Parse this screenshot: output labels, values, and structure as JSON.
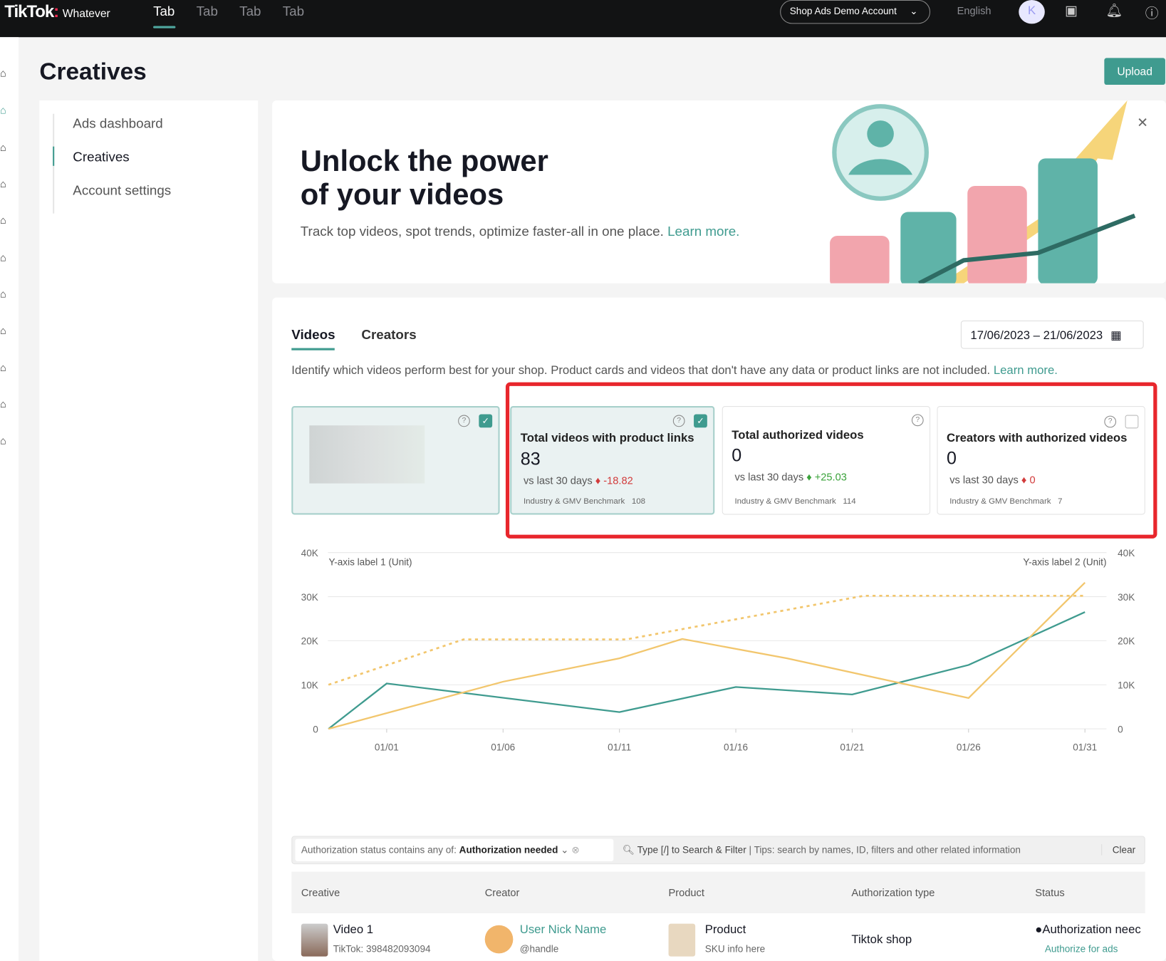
{
  "topbar": {
    "logo": "TikTok",
    "logo_sub": "Whatever",
    "tabs": [
      "Tab",
      "Tab",
      "Tab",
      "Tab"
    ],
    "account": "Shop Ads Demo Account",
    "language": "English",
    "avatar_initial": "K"
  },
  "page": {
    "title": "Creatives",
    "upload": "Upload"
  },
  "nav": {
    "items": [
      "Ads dashboard",
      "Creatives",
      "Account settings"
    ]
  },
  "banner": {
    "title_line1": "Unlock the power",
    "title_line2": "of your videos",
    "text": "Track top videos, spot trends, optimize faster-all in one place.",
    "link": "Learn more."
  },
  "panel": {
    "tabs": [
      "Videos",
      "Creators"
    ],
    "date_start": "17/06/2023",
    "date_sep": "–",
    "date_end": "21/06/2023",
    "description": "Identify which videos perform best for your shop. Product cards and videos that don't have any data or product links are not included.",
    "learn_more": "Learn more."
  },
  "cards": [
    {
      "title": "Total videos with product links",
      "value": "83",
      "vs": "vs last 30 days",
      "arrow": "♦",
      "change": "-18.82",
      "benchmark_label": "Industry & GMV Benchmark",
      "benchmark": "108"
    },
    {
      "title": "Total authorized videos",
      "value": "0",
      "vs": "vs last 30 days",
      "arrow": "♦",
      "change": "+25.03",
      "benchmark_label": "Industry & GMV Benchmark",
      "benchmark": "114"
    },
    {
      "title": "Creators with authorized videos",
      "value": "0",
      "vs": "vs last 30 days",
      "arrow": "♦",
      "change": "0",
      "benchmark_label": "Industry & GMV Benchmark",
      "benchmark": "7"
    }
  ],
  "chart_data": {
    "type": "line",
    "ylabel": "Y-axis label 1 (Unit)",
    "ylabel2": "Y-axis label 2 (Unit)",
    "ylim": [
      0,
      40000
    ],
    "yticks": [
      "0",
      "10K",
      "20K",
      "30K",
      "40K"
    ],
    "xticks": [
      "01/01",
      "01/06",
      "01/11",
      "01/16",
      "01/21",
      "01/26",
      "01/31"
    ],
    "series": [
      {
        "name": "teal",
        "color": "#3f9b8f",
        "dash": false,
        "points": [
          [
            -2.5,
            0
          ],
          [
            0,
            10300
          ],
          [
            10,
            3800
          ],
          [
            15,
            9500
          ],
          [
            20,
            7800
          ],
          [
            25,
            14500
          ],
          [
            30,
            26500
          ]
        ]
      },
      {
        "name": "yellow",
        "color": "#f2c66d",
        "dash": false,
        "points": [
          [
            -2.5,
            0
          ],
          [
            5,
            10700
          ],
          [
            10,
            16000
          ],
          [
            12.7,
            20400
          ],
          [
            17.2,
            16000
          ],
          [
            25,
            7000
          ],
          [
            30,
            33200
          ]
        ]
      },
      {
        "name": "yellow-dotted",
        "color": "#f2c66d",
        "dash": true,
        "points": [
          [
            -2.5,
            10000
          ],
          [
            3.3,
            20300
          ],
          [
            10.3,
            20300
          ],
          [
            20.5,
            30200
          ],
          [
            30,
            30200
          ]
        ]
      }
    ]
  },
  "filter": {
    "prefix": "Authorization status contains any of:",
    "value": "Authorization needed",
    "search": "Type [/] to Search & Filter",
    "tips": "Tips: search by names, ID, filters and other related information",
    "clear": "Clear"
  },
  "table": {
    "headers": [
      "Creative",
      "Creator",
      "Product",
      "Authorization type",
      "Status"
    ],
    "rows": [
      {
        "video": "Video 1",
        "video_id": "TikTok: 398482093094",
        "creator": "User Nick Name",
        "handle": "@handle",
        "product": "Product",
        "sku": "SKU info here",
        "auth_type": "Tiktok shop",
        "status": "Authorization neec",
        "action": "Authorize for ads"
      }
    ]
  }
}
